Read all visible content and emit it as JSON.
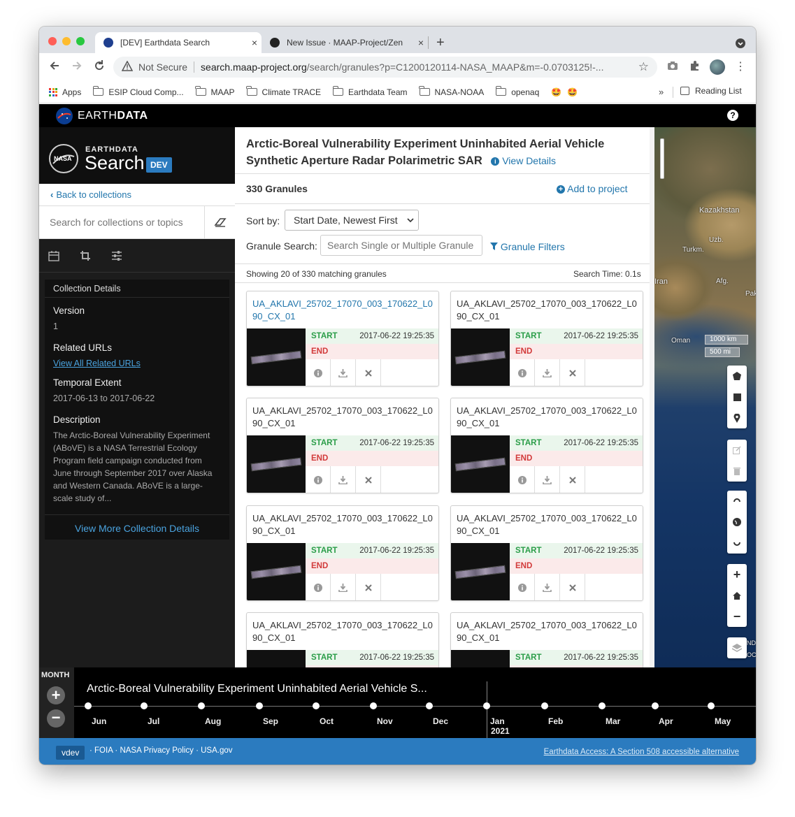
{
  "browser": {
    "tabs": [
      {
        "title": "[DEV] Earthdata Search",
        "close": "×"
      },
      {
        "title": "New Issue · MAAP-Project/Zen",
        "close": "×"
      }
    ],
    "new_tab": "+",
    "security_label": "Not Secure",
    "url_host": "search.maap-project.org",
    "url_path": "/search/granules?p=C1200120114-NASA_MAAP&m=-0.0703125!-...",
    "bookmarks": [
      "Apps",
      "ESIP Cloud Comp...",
      "MAAP",
      "Climate TRACE",
      "Earthdata Team",
      "NASA-NOAA",
      "openaq",
      "🤩",
      "🤩"
    ],
    "bookmarks_more": "»",
    "reading_list": "Reading List"
  },
  "header": {
    "brand_light": "EARTH",
    "brand_bold": "DATA",
    "help_icon": "?"
  },
  "sidebar": {
    "logo_top": "EARTHDATA",
    "logo_main": "Search",
    "env_badge": "DEV",
    "back_link": "Back to collections",
    "search_placeholder": "Search for collections or topics",
    "panel_title": "Collection Details",
    "version_label": "Version",
    "version_value": "1",
    "related_label": "Related URLs",
    "related_link": "View All Related URLs",
    "temporal_label": "Temporal Extent",
    "temporal_value": "2017-06-13 to 2017-06-22",
    "description_label": "Description",
    "description_text": "The Arctic-Boreal Vulnerability Experiment (ABoVE) is a NASA Terrestrial Ecology Program field campaign conducted from June through September 2017 over Alaska and Western Canada. ABoVE is a large-scale study of...",
    "more_details": "View More Collection Details"
  },
  "results": {
    "title_line1": "Arctic-Boreal Vulnerability Experiment Uninhabited Aerial Vehicle",
    "title_line2": "Synthetic Aperture Radar Polarimetric SAR",
    "view_details": "View Details",
    "granule_count": "330 Granules",
    "add_to_project": "Add to project",
    "sort_label": "Sort by:",
    "sort_value": "Start Date, Newest First",
    "granule_search_label": "Granule Search:",
    "granule_search_placeholder": "Search Single or Multiple Granule",
    "granule_filters": "Granule Filters",
    "showing": "Showing 20 of 330 matching granules",
    "search_time": "Search Time: 0.1s",
    "start_label": "START",
    "end_label": "END",
    "granules": [
      {
        "id": "UA_AKLAVI_25702_17070_003_170622_L090_CX_01",
        "start": "2017-06-22 19:25:35",
        "highlighted": true
      },
      {
        "id": "UA_AKLAVI_25702_17070_003_170622_L090_CX_01",
        "start": "2017-06-22 19:25:35",
        "highlighted": false
      },
      {
        "id": "UA_AKLAVI_25702_17070_003_170622_L090_CX_01",
        "start": "2017-06-22 19:25:35",
        "highlighted": false
      },
      {
        "id": "UA_AKLAVI_25702_17070_003_170622_L090_CX_01",
        "start": "2017-06-22 19:25:35",
        "highlighted": false
      },
      {
        "id": "UA_AKLAVI_25702_17070_003_170622_L090_CX_01",
        "start": "2017-06-22 19:25:35",
        "highlighted": false
      },
      {
        "id": "UA_AKLAVI_25702_17070_003_170622_L090_CX_01",
        "start": "2017-06-22 19:25:35",
        "highlighted": false
      },
      {
        "id": "UA_AKLAVI_25702_17070_003_170622_L090_CX_01",
        "start": "2017-06-22 19:25:35",
        "highlighted": false
      },
      {
        "id": "UA_AKLAVI_25702_17070_003_170622_L090_CX_01",
        "start": "2017-06-22 19:25:35",
        "highlighted": false
      }
    ]
  },
  "map": {
    "labels": [
      "Kazakhstan",
      "Uzb.",
      "Turkm.",
      "Afg.",
      "Pak",
      "Iran",
      "Oman",
      "ND",
      "OC"
    ],
    "scale_km": "1000 km",
    "scale_mi": "500 mi"
  },
  "timeline": {
    "zoom_level": "MONTH",
    "collection_title": "Arctic-Boreal Vulnerability Experiment Uninhabited Aerial Vehicle S...",
    "months": [
      "Jun",
      "Jul",
      "Aug",
      "Sep",
      "Oct",
      "Nov",
      "Dec",
      "Jan",
      "Feb",
      "Mar",
      "Apr",
      "May"
    ],
    "year_label": "2021"
  },
  "footer": {
    "version": "vdev",
    "links": "· FOIA · NASA Privacy Policy · USA.gov",
    "accessible": "Earthdata Access: A Section 508 accessible alternative"
  },
  "colors": {
    "accent": "#2276ac",
    "dev_badge": "#2b7bbf",
    "start_green": "#2a9d48",
    "end_red": "#d23a3a",
    "footer_bg": "#2b7bbf"
  }
}
